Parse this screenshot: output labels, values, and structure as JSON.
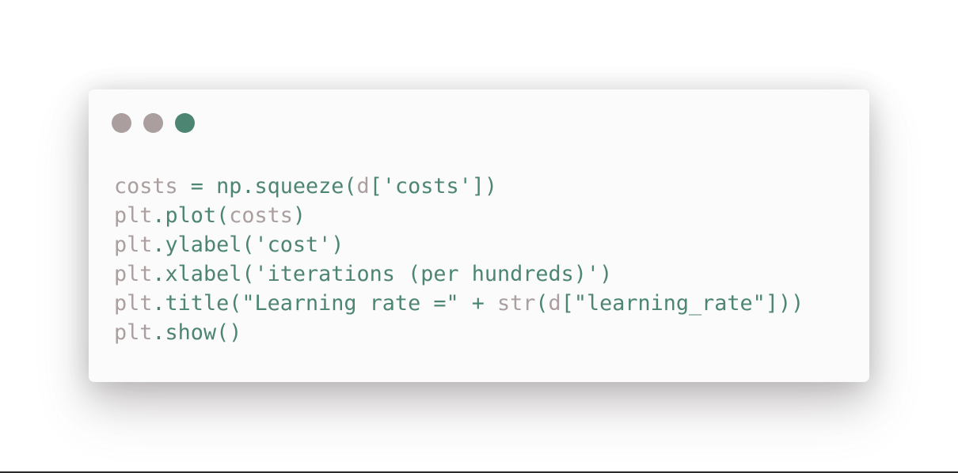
{
  "window": {
    "background": "#fbfbfb",
    "traffic_lights": [
      {
        "name": "close",
        "color": "#ab9e9e"
      },
      {
        "name": "minimize",
        "color": "#ab9e9e"
      },
      {
        "name": "maximize",
        "color": "#4d8573"
      }
    ]
  },
  "theme": {
    "identifier": "#ab9e9e",
    "default": "#4d8573"
  },
  "code_lines": [
    [
      {
        "t": "costs",
        "c": "identifier"
      },
      {
        "t": " = np.squeeze(",
        "c": "default"
      },
      {
        "t": "d",
        "c": "identifier"
      },
      {
        "t": "['costs'])",
        "c": "default"
      }
    ],
    [
      {
        "t": "plt",
        "c": "identifier"
      },
      {
        "t": ".plot(",
        "c": "default"
      },
      {
        "t": "costs",
        "c": "identifier"
      },
      {
        "t": ")",
        "c": "default"
      }
    ],
    [
      {
        "t": "plt",
        "c": "identifier"
      },
      {
        "t": ".ylabel('cost')",
        "c": "default"
      }
    ],
    [
      {
        "t": "plt",
        "c": "identifier"
      },
      {
        "t": ".xlabel('iterations (per hundreds)')",
        "c": "default"
      }
    ],
    [
      {
        "t": "plt",
        "c": "identifier"
      },
      {
        "t": ".title(\"Learning rate =\" + ",
        "c": "default"
      },
      {
        "t": "str",
        "c": "identifier"
      },
      {
        "t": "(",
        "c": "default"
      },
      {
        "t": "d",
        "c": "identifier"
      },
      {
        "t": "[\"learning_rate\"]))",
        "c": "default"
      }
    ],
    [
      {
        "t": "plt",
        "c": "identifier"
      },
      {
        "t": ".show()",
        "c": "default"
      }
    ]
  ]
}
